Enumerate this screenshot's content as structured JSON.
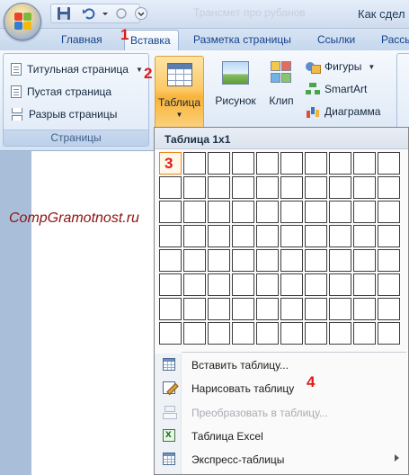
{
  "title_bar": {
    "ghost_text": "Трансмет про рубанов",
    "title": "Как сдел"
  },
  "quick_access": {
    "icons": [
      "save-icon",
      "undo-icon",
      "redo-icon",
      "customize-icon"
    ]
  },
  "tabs": [
    {
      "label": "Главная"
    },
    {
      "label": "Вставка",
      "active": true
    },
    {
      "label": "Разметка страницы"
    },
    {
      "label": "Ссылки"
    },
    {
      "label": "Рассы"
    }
  ],
  "annotations": {
    "n1": "1",
    "n2": "2",
    "n3": "3",
    "n4": "4"
  },
  "pages_group": {
    "label": "Страницы",
    "items": [
      {
        "label": "Титульная страница",
        "icon": "cover-page-icon"
      },
      {
        "label": "Пустая страница",
        "icon": "blank-page-icon"
      },
      {
        "label": "Разрыв страницы",
        "icon": "page-break-icon"
      }
    ]
  },
  "ribbon": {
    "table_label": "Таблица",
    "picture_label": "Рисунок",
    "clip_label": "Клип",
    "shapes_label": "Фигуры",
    "smartart_label": "SmartArt",
    "chart_label": "Диаграмма"
  },
  "watermark": "CompGramotnost.ru",
  "dropdown": {
    "header": "Таблица 1x1",
    "grid": {
      "columns": 10,
      "rows": 8,
      "selected": [
        1,
        1
      ]
    },
    "menu": [
      {
        "label": "Вставить таблицу...",
        "icon": "insert-table-icon",
        "enabled": true
      },
      {
        "label": "Нарисовать таблицу",
        "icon": "draw-table-icon",
        "enabled": true
      },
      {
        "label": "Преобразовать в таблицу...",
        "icon": "convert-to-table-icon",
        "enabled": false
      },
      {
        "label": "Таблица Excel",
        "icon": "excel-table-icon",
        "enabled": true
      },
      {
        "label": "Экспресс-таблицы",
        "icon": "quick-tables-icon",
        "enabled": true,
        "submenu": true
      }
    ]
  },
  "colors": {
    "annotation_red": "#e01818",
    "watermark": "#8c1313",
    "highlight_orange": "#f9b338"
  }
}
